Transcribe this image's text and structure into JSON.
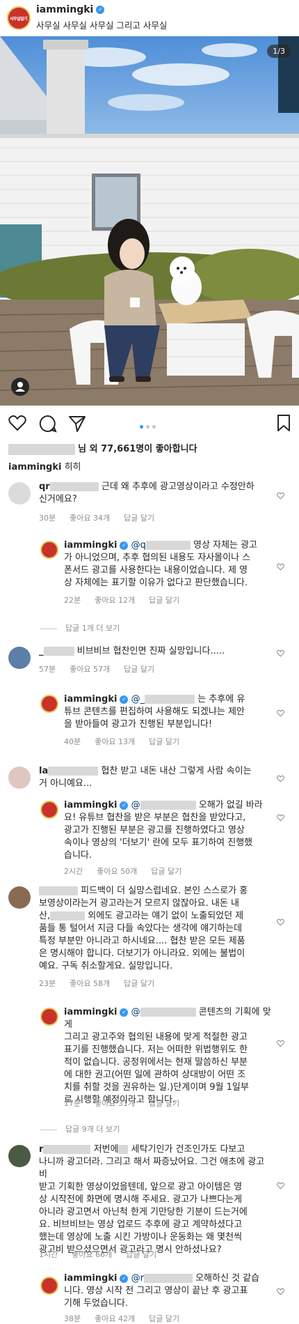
{
  "header": {
    "avatar_text": "사무실일기",
    "username": "iammingki",
    "location": "사무실 사무실 사무실 그리고 사무실"
  },
  "photo": {
    "counter": "1/3"
  },
  "likes": {
    "suffix": "님 외 77,661명이 좋아합니다"
  },
  "caption": {
    "username": "iammingki",
    "text": "히히"
  },
  "comments": [
    {
      "user": "qr",
      "text1": "근데 왜 추후에 광고영상이라고 수정안하",
      "text2": "신거에요?",
      "time": "30분",
      "likes": "좋아요 34개",
      "reply": "답글 달기"
    },
    {
      "user": "iammingki",
      "mention": "@q",
      "text1": "영상 자체는 광고",
      "text2": "가 아니었으며, 추후 협의된 내용도 자사몰이나 스",
      "text3": "폰서드 광고를 사용한다는 내용이었습니다. 제 영",
      "text4": "상 자체에는 표기할 이유가 없다고 판단했습니다.",
      "time": "22분",
      "likes": "좋아요 12개",
      "reply": "답글 달기",
      "view_replies": "답글 1개 더 보기"
    },
    {
      "user": "_",
      "text1": "비브비브 협찬인면 진짜 실망입니다.....",
      "time": "57분",
      "likes": "좋아요 57개",
      "reply": "답글 달기"
    },
    {
      "user": "iammingki",
      "mention": "@_",
      "text1": "는 추후에 유",
      "text2": "튜브 콘텐츠를 편집하여 사용해도 되겠냐는 제안",
      "text3": "을 받아들여 광고가 진행된 부분입니다!",
      "time": "40분",
      "likes": "좋아요 13개",
      "reply": "답글 달기"
    },
    {
      "user": "la",
      "text1": "협찬 받고 내돈 내산 그렇게 사람 속이는",
      "text2": "거 아니예요...",
      "time": "",
      "likes": "",
      "reply": ""
    },
    {
      "user": "iammingki",
      "mention": "@",
      "text1": "오해가 없길 바라",
      "text2": "요! 유튜브 협찬을 받은 부분은 협찬을 받았다고,",
      "text3": "광고가 진행된 부분은 광고를 진행하였다고 영상",
      "text4": "속이나 영상의 '더보기' 란에 모두 표기하여 진행했",
      "text5": "습니다.",
      "time": "2시간",
      "likes": "좋아요 50개",
      "reply": "답글 달기"
    },
    {
      "user": "",
      "text1": "피드백이 더 실망스럽네요. 본인 스스로가 홍",
      "text2": "보영상이라는거 광고라는거 모르지 않잖아요. 내돈 내",
      "text3": "산,",
      "text3b": "외에도 광고라는 얘기 없이 노출되었던 제",
      "text4": "품들 통 털어서 지금 다들 속았다는 생각에 얘기하는데",
      "text5": "특정 부분만 아니라고 하시네요.... 협찬 받은 모든 제품",
      "text6": "은 명시해야 합니다. 더보기가 아니라요. 외에는 불법이",
      "text7": "예요. 구독 취소할게요. 실망입니다.",
      "time": "23분",
      "likes": "좋아요 58개",
      "reply": "답글 달기"
    },
    {
      "user": "iammingki",
      "mention": "@",
      "text1": "콘텐츠의 기획에 맞게",
      "text2": "그리고 광고주와 협의된 내용에 맞게 적절한 광고",
      "text3": "표기를 진행했습니다. 저는 어떠한 위법행위도 한",
      "text4": "적이 없습니다. 공정위에서는 현재 말씀하신 부분",
      "text5": "에 대한 권고(어떤 일에 관하여 상대방이 어떤 조",
      "text6": "치를 취할 것을 권유하는 일.)단계이며 9월 1일부",
      "text7": "로 시행할 예정이라고 합니다.",
      "time": "17분",
      "likes": "좋아요 31개",
      "reply": "답글 달기",
      "view_replies": "답글 9개 더 보기"
    },
    {
      "user": "r",
      "text1": "저번에",
      "text1b": "세탁기인가 건조인가도 다보고",
      "text2": "나니까 광고더라. 그리고 해서 짜증났어요. 그건 애초에 광고비",
      "text3": "받고 기획한 영상이었을텐데, 앞으로 광고 아이템은 영",
      "text4": "상 시작전에 화면에 명시해 주세요. 광고가 나쁘다는게",
      "text5": "아니라 광고면서 아닌척 한게 기만당한 기분이 드는거에",
      "text6": "요. 비브비브는 영상 업로드 추후에 광고 계약하셨다고",
      "text7": "했는데 영상에 노출 시킨 가방이나 운동화는 왜 몇천씩",
      "text8": "광고비 받으셨으면서 광고라고 명시 안하셨나요?",
      "time": "1시간",
      "likes": "좋아요 66개",
      "reply": "답글 달기"
    },
    {
      "user": "iammingki",
      "mention": "@r",
      "text1": "오해하신 것 같습",
      "text2": "니다. 영상 시작 전 그리고 영상이 끝난 후 광고표",
      "text3": "기해 두었습니다.",
      "time": "38분",
      "likes": "좋아요 42개",
      "reply": "답글 달기"
    }
  ],
  "colors": {
    "verified": "#3897f0",
    "meta": "#8e8e8e",
    "text": "#262626"
  },
  "icons": [
    "heart-icon",
    "comment-icon",
    "share-icon",
    "bookmark-icon",
    "user-tag-icon"
  ]
}
